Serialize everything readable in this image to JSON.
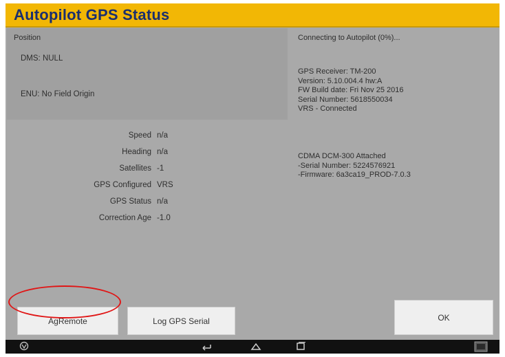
{
  "window": {
    "title": "Autopilot GPS Status"
  },
  "position": {
    "heading": "Position",
    "dms": "DMS: NULL",
    "enu": "ENU: No Field Origin"
  },
  "stats": [
    {
      "label": "Speed",
      "value": "n/a"
    },
    {
      "label": "Heading",
      "value": "n/a"
    },
    {
      "label": "Satellites",
      "value": "-1"
    },
    {
      "label": "GPS Configured",
      "value": "VRS"
    },
    {
      "label": "GPS Status",
      "value": "n/a"
    },
    {
      "label": "Correction Age",
      "value": "-1.0"
    }
  ],
  "connection": {
    "status": "Connecting to Autopilot (0%)..."
  },
  "receiver": [
    "GPS Receiver: TM-200",
    "Version: 5.10.004.4 hw:A",
    "FW Build date: Fri Nov 25 2016",
    "Serial Number: 5618550034",
    "VRS - Connected"
  ],
  "modem": [
    "CDMA DCM-300 Attached",
    "-Serial Number: 5224576921",
    "-Firmware: 6a3ca19_PROD-7.0.3"
  ],
  "buttons": {
    "agremote": "AgRemote",
    "log_gps_serial": "Log GPS Serial",
    "ok": "OK"
  },
  "navbar": {
    "left_icon": "trimble-globe-icon",
    "back_icon": "back-icon",
    "home_icon": "home-icon",
    "recents_icon": "recents-icon",
    "right_icon": "screenshot-icon"
  },
  "colors": {
    "title_bar": "#f2b705",
    "title_text": "#1b2f6e",
    "panel_bg": "#a9a9a9",
    "highlight": "#e01616"
  }
}
